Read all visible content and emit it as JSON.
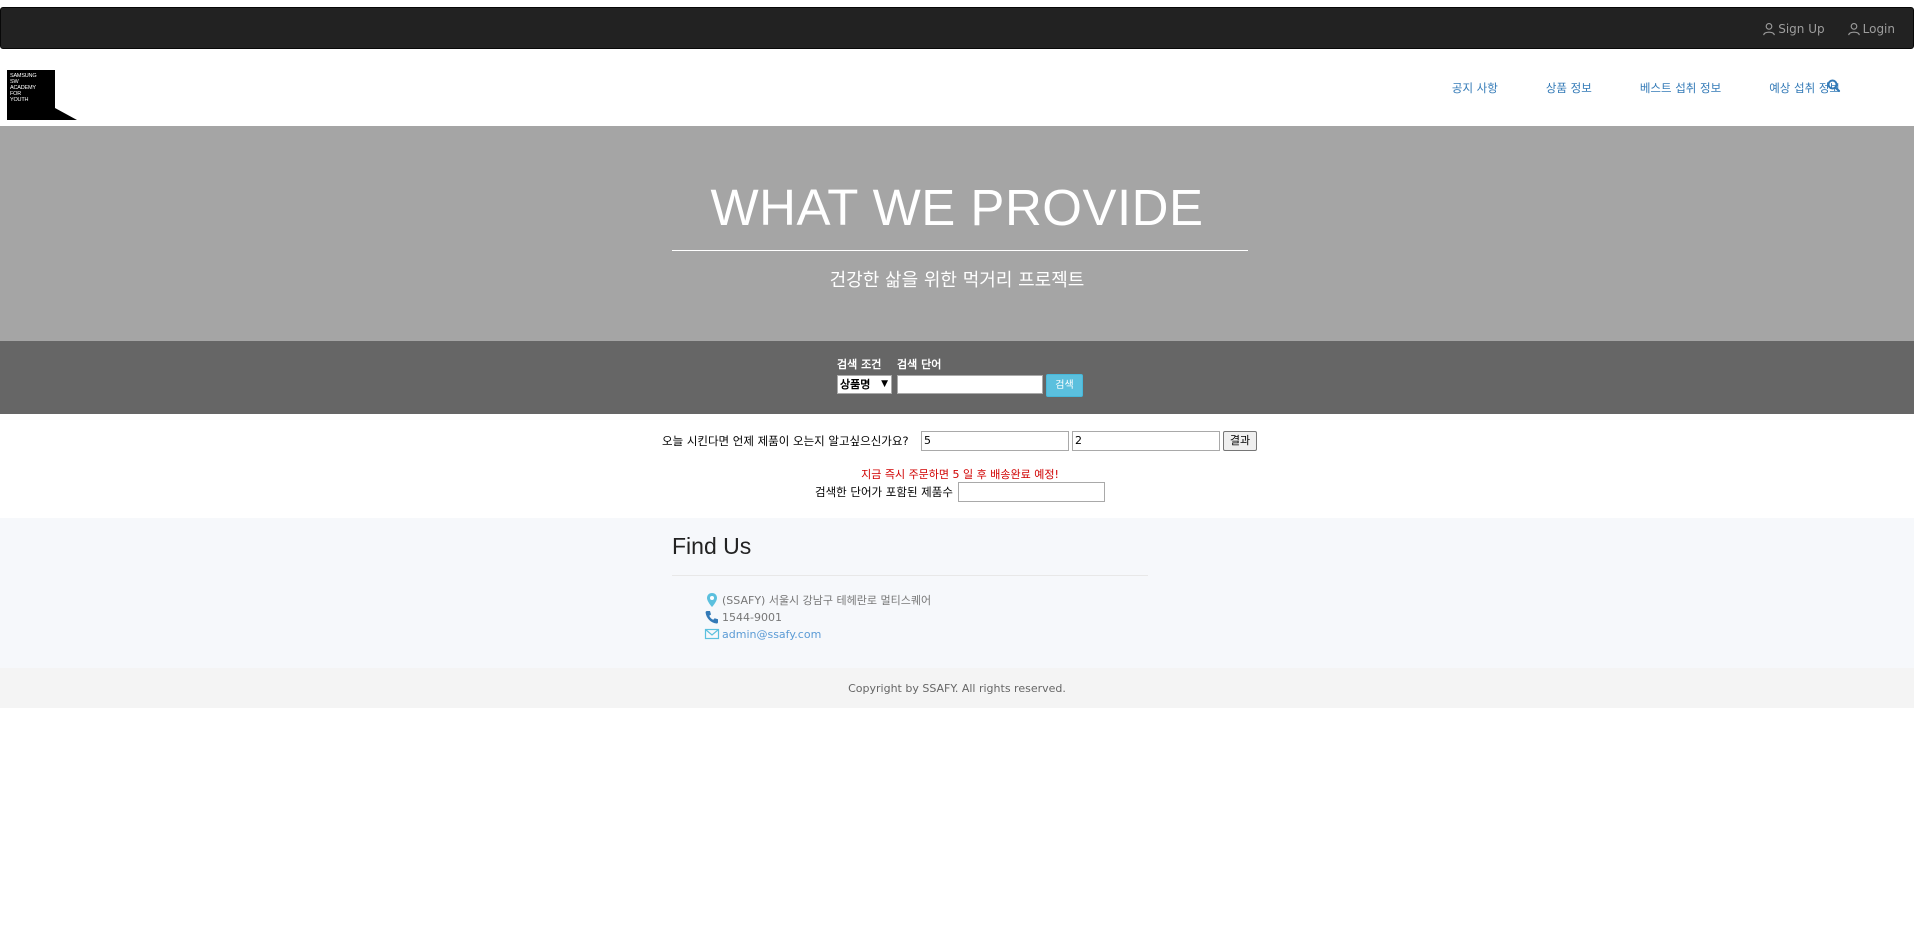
{
  "topbar": {
    "signup_label": "Sign Up",
    "login_label": "Login"
  },
  "logo": {
    "line1": "SAMSUNG",
    "line2": "SW",
    "line3": "ACADEMY",
    "line4": "FOR",
    "line5": "YOUTH"
  },
  "nav": {
    "items": [
      {
        "label": "공지 사항"
      },
      {
        "label": "상품 정보"
      },
      {
        "label": "베스트 섭취 정보"
      },
      {
        "label": "예상 섭취 정보"
      }
    ],
    "search_icon": "search-icon"
  },
  "hero": {
    "title": "WHAT WE PROVIDE",
    "subtitle": "건강한 삶을 위한 먹거리 프로젝트"
  },
  "search": {
    "condition_label": "검색 조건",
    "keyword_label": "검색 단어",
    "condition_value": "상품명",
    "keyword_value": "",
    "button_label": "검색"
  },
  "delivery": {
    "question": "오늘 시킨다면 언제 제품이 오는지 알고싶으신가요?",
    "field1_value": "5",
    "field2_value": "2",
    "button_label": "결과",
    "result_text": "지금 즉시 주문하면 5 일 후 배송완료 예정!",
    "count_label": "검색한 단어가 포함된 제품수",
    "count_value": ""
  },
  "findus": {
    "title": "Find Us",
    "address": "(SSAFY) 서울시 강남구 테헤란로 멀티스퀘어",
    "phone": "1544-9001",
    "email": "admin@ssafy.com"
  },
  "footer": {
    "copyright": "Copyright by SSAFY. All rights reserved."
  },
  "colors": {
    "topbar": "#222222",
    "hero": "#a5a5a5",
    "searchband": "#666666",
    "search_button": "#5bc0de",
    "link": "#337ab7",
    "result_red": "#d00000"
  }
}
